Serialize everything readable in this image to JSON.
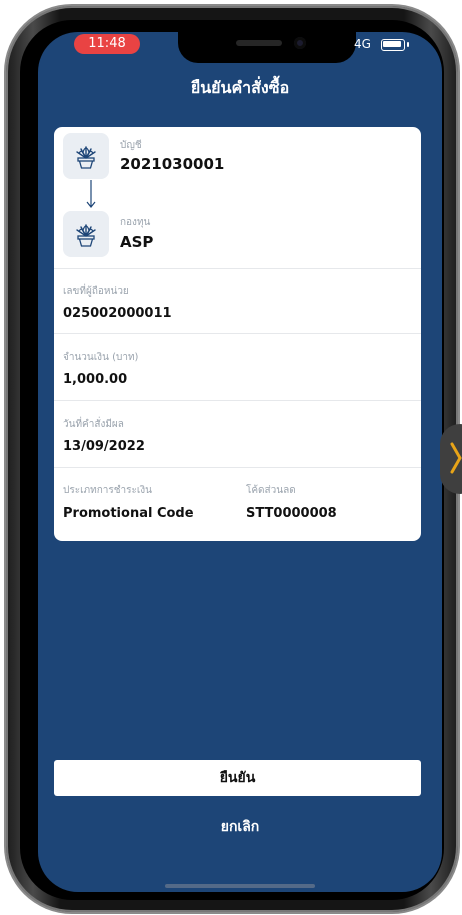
{
  "status_bar": {
    "time": "11:48",
    "network": "4G"
  },
  "header": {
    "title": "ยืนยันคำสั่งซื้อ"
  },
  "order": {
    "account_label": "บัญชี",
    "account_value": "2021030001",
    "fund_label": "กองทุน",
    "fund_value": "ASP",
    "unitholder_label": "เลขที่ผู้ถือหน่วย",
    "unitholder_value": "025002000011",
    "amount_label": "จำนวนเงิน (บาท)",
    "amount_value": "1,000.00",
    "effective_date_label": "วันที่คำสั่งมีผล",
    "effective_date_value": "13/09/2022",
    "payment_type_label": "ประเภทการชำระเงิน",
    "payment_type_value": "Promotional Code",
    "discount_code_label": "โค้ดส่วนลด",
    "discount_code_value": "STT0000008"
  },
  "actions": {
    "confirm_label": "ยืนยัน",
    "cancel_label": "ยกเลิก"
  },
  "colors": {
    "screen_bg": "#1d4577",
    "time_pill": "#e94343",
    "card_bg": "#ffffff"
  },
  "icons": [
    "plant-pot-icon",
    "arrow-down-icon",
    "battery-icon",
    "chevron-icon"
  ]
}
